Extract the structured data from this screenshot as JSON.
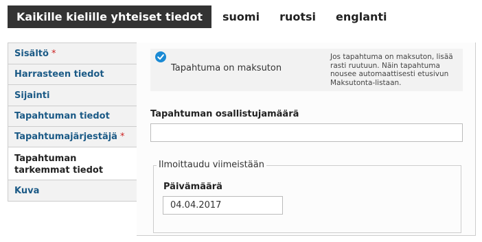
{
  "language_tabs": [
    {
      "label": "Kaikille kielille yhteiset tiedot",
      "active": true
    },
    {
      "label": "suomi",
      "active": false
    },
    {
      "label": "ruotsi",
      "active": false
    },
    {
      "label": "englanti",
      "active": false
    }
  ],
  "vertical_tabs": [
    {
      "label": "Sisältö",
      "required": true
    },
    {
      "label": "Harrasteen tiedot",
      "required": false
    },
    {
      "label": "Sijainti",
      "required": false
    },
    {
      "label": "Tapahtuman tiedot",
      "required": false
    },
    {
      "label": "Tapahtumajärjestäjä",
      "required": true
    },
    {
      "label": "Tapahtuman tarkemmat tiedot",
      "required": false,
      "active": true
    },
    {
      "label": "Kuva",
      "required": false
    }
  ],
  "required_marker": "*",
  "free_event": {
    "checked": true,
    "icon": "check-circle-icon",
    "label": "Tapahtuma on maksuton",
    "help": "Jos tapahtuma on maksuton, lisää rasti ruutuun. Näin tapahtuma nousee automaattisesti etusivun Maksutonta-listaan."
  },
  "participant_count": {
    "label": "Tapahtuman osallistujamäärä",
    "value": ""
  },
  "registration": {
    "legend": "Ilmoittaudu viimeistään",
    "date_label": "Päivämäärä",
    "date_value": "04.04.2017"
  },
  "colors": {
    "active_tab_bg": "#333333",
    "link": "#1b5a86",
    "required": "#cc2222",
    "check": "#1a8ad4"
  }
}
